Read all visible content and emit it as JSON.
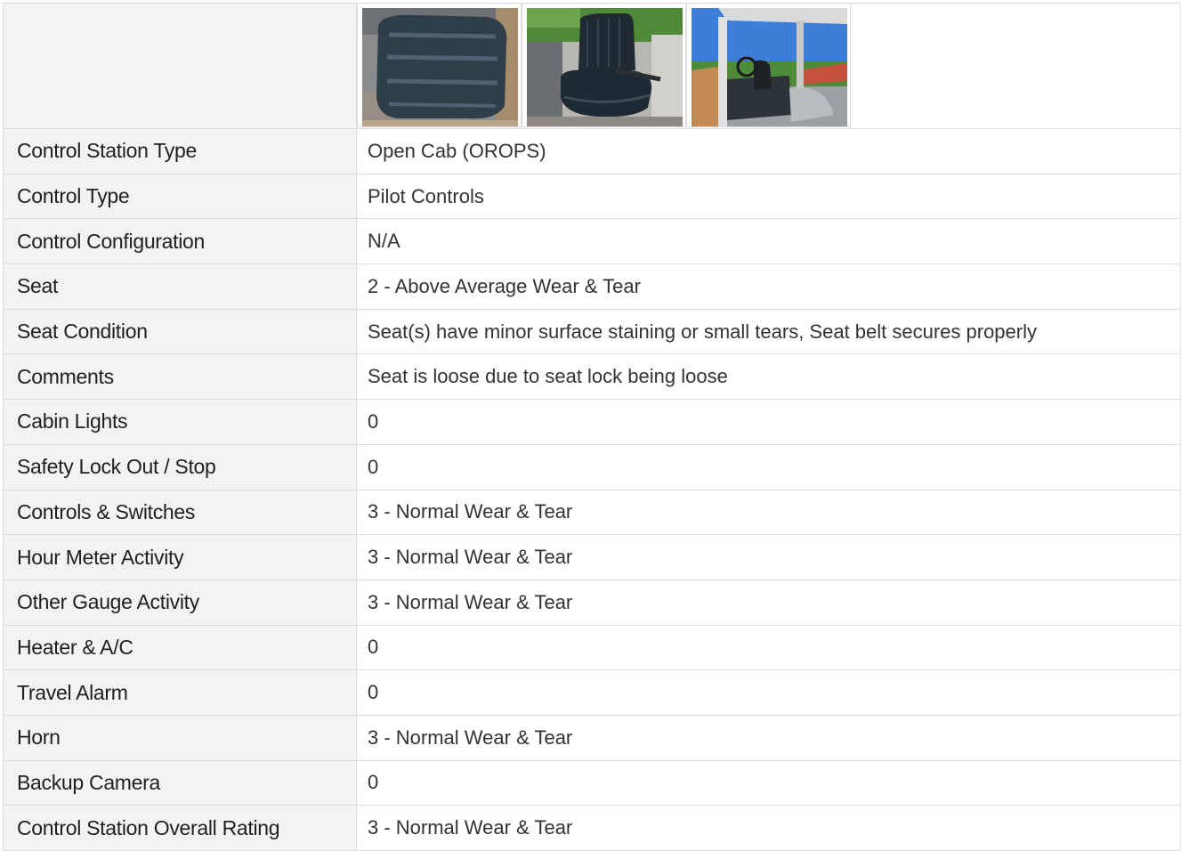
{
  "photos": [
    {
      "name": "seat-closeup-photo"
    },
    {
      "name": "seat-with-belt-photo"
    },
    {
      "name": "open-cab-photo"
    }
  ],
  "rows": [
    {
      "label": "Control Station Type",
      "value": "Open Cab (OROPS)"
    },
    {
      "label": "Control Type",
      "value": "Pilot Controls"
    },
    {
      "label": "Control Configuration",
      "value": "N/A"
    },
    {
      "label": "Seat",
      "value": "2 - Above Average Wear & Tear"
    },
    {
      "label": "Seat Condition",
      "value": "Seat(s) have minor surface staining or small tears, Seat belt secures properly"
    },
    {
      "label": "Comments",
      "value": "Seat is loose due to seat lock being loose"
    },
    {
      "label": "Cabin Lights",
      "value": "0"
    },
    {
      "label": "Safety Lock Out / Stop",
      "value": "0"
    },
    {
      "label": "Controls & Switches",
      "value": "3 - Normal Wear & Tear"
    },
    {
      "label": "Hour Meter Activity",
      "value": "3 - Normal Wear & Tear"
    },
    {
      "label": "Other Gauge Activity",
      "value": "3 - Normal Wear & Tear"
    },
    {
      "label": "Heater & A/C",
      "value": "0"
    },
    {
      "label": "Travel Alarm",
      "value": "0"
    },
    {
      "label": "Horn",
      "value": "3 - Normal Wear & Tear"
    },
    {
      "label": "Backup Camera",
      "value": "0"
    },
    {
      "label": "Control Station Overall Rating",
      "value": "3 - Normal Wear & Tear"
    }
  ]
}
